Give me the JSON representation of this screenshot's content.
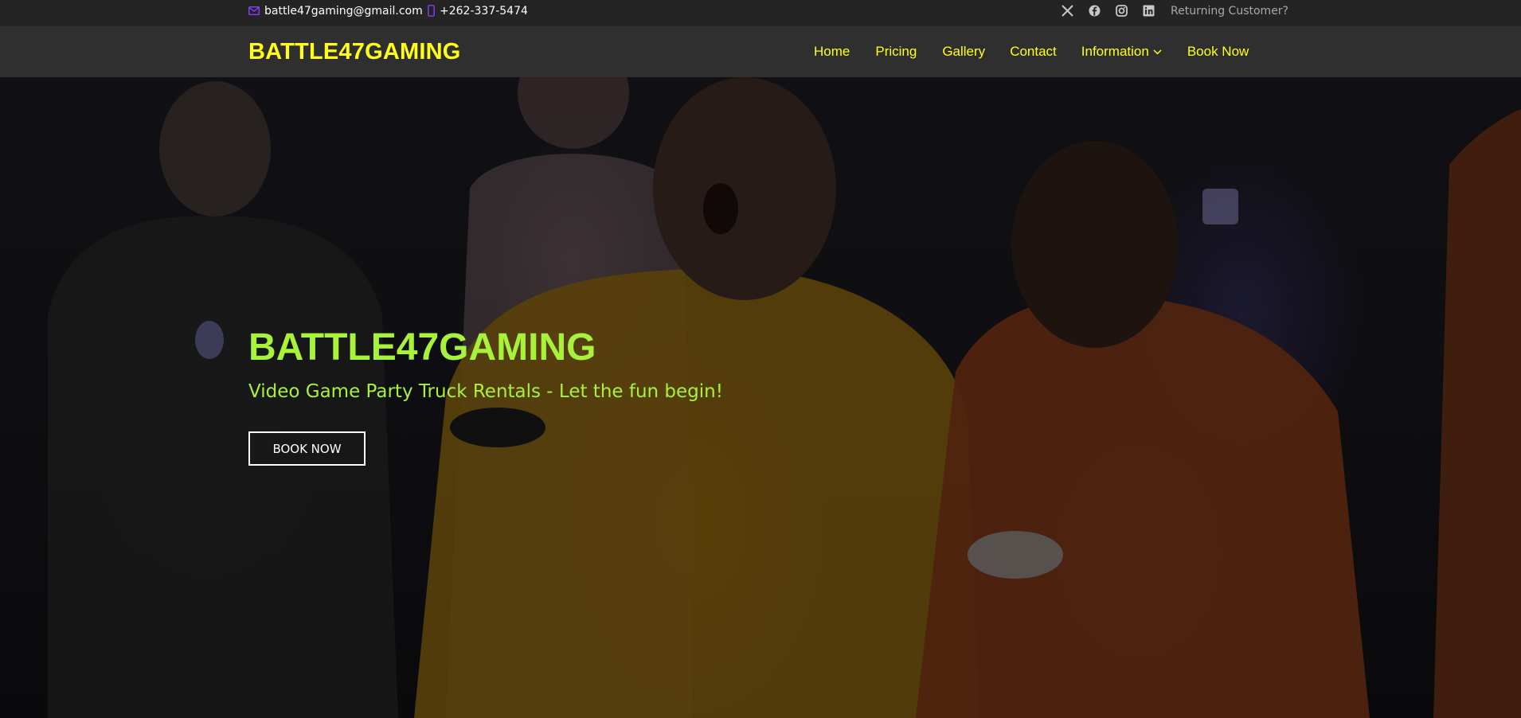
{
  "topbar": {
    "email": "battle47gaming@gmail.com",
    "phone": "+262-337-5474",
    "socials": [
      "x-icon",
      "facebook-icon",
      "instagram-icon",
      "linkedin-icon"
    ],
    "returning_customer": "Returning Customer?"
  },
  "header": {
    "logo": "BATTLE47GAMING",
    "nav": [
      {
        "label": "Home"
      },
      {
        "label": "Pricing"
      },
      {
        "label": "Gallery"
      },
      {
        "label": "Contact"
      },
      {
        "label": "Information",
        "has_dropdown": true
      },
      {
        "label": "Book Now"
      }
    ]
  },
  "hero": {
    "title": "BATTLE47GAMING",
    "subtitle": "Video Game Party Truck Rentals - Let the fun begin!",
    "cta_label": "BOOK NOW"
  },
  "colors": {
    "accent_yellow": "#ffff1a",
    "hero_green": "#a8f23a",
    "topbar_bg": "#242424",
    "header_bg": "#2f2f2f",
    "icon_purple": "#8a3cff"
  }
}
